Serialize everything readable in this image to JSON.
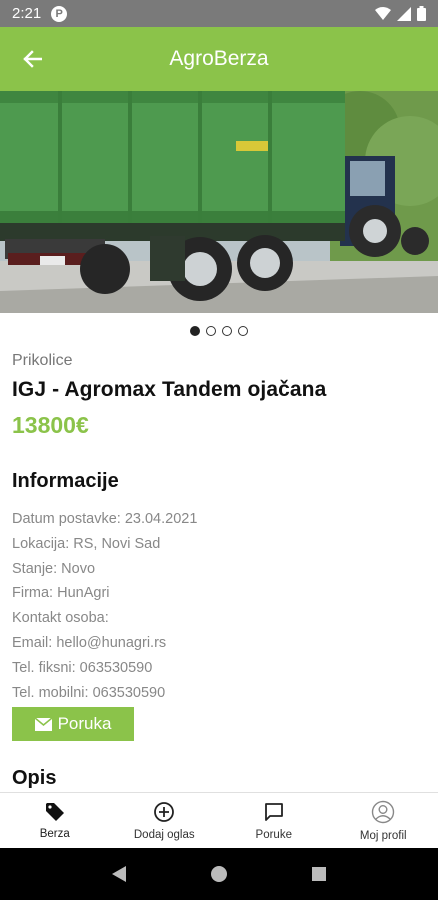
{
  "status_bar": {
    "time": "2:21",
    "badge": "P"
  },
  "app_bar": {
    "title": "AgroBerza"
  },
  "carousel": {
    "page_count": 4,
    "active_index": 0
  },
  "listing": {
    "category": "Prikolice",
    "title": "IGJ - Agromax Tandem ojačana",
    "price": "13800€"
  },
  "info": {
    "heading": "Informacije",
    "rows": [
      "Datum postavke: 23.04.2021",
      "Lokacija: RS, Novi Sad",
      "Stanje: Novo",
      "Firma: HunAgri",
      "Kontakt osoba:",
      "Email: hello@hunagri.rs",
      "Tel. fiksni: 063530590",
      "Tel. mobilni: 063530590"
    ]
  },
  "message_button": {
    "label": "Poruka"
  },
  "description": {
    "heading": "Opis"
  },
  "bottom_nav": {
    "items": [
      {
        "label": "Berza",
        "icon": "tag-icon"
      },
      {
        "label": "Dodaj oglas",
        "icon": "add-circle-icon"
      },
      {
        "label": "Poruke",
        "icon": "chat-icon"
      },
      {
        "label": "Moj profil",
        "icon": "account-icon"
      }
    ]
  },
  "colors": {
    "accent": "#8bc34a",
    "status_bar": "#7a7a7a"
  }
}
